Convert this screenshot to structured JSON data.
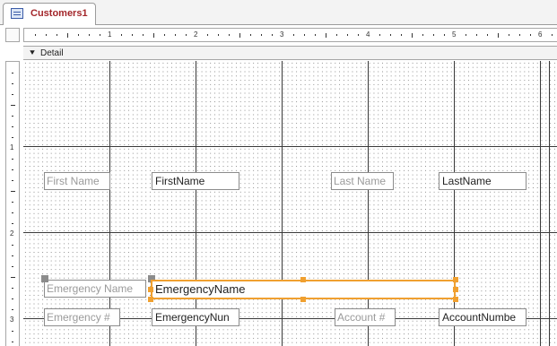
{
  "tab": {
    "title": "Customers1",
    "icon": "form-icon"
  },
  "ruler": {
    "horizontal_marks": [
      "1",
      "2",
      "3",
      "4",
      "5",
      "6"
    ],
    "vertical_marks": [
      "1",
      "2",
      "3"
    ]
  },
  "section": {
    "label": "Detail",
    "icon": "section-arrow-icon"
  },
  "controls": {
    "first_name_label": "First Name",
    "first_name_field": "FirstName",
    "last_name_label": "Last Name",
    "last_name_field": "LastName",
    "emergency_name_label": "Emergency Name",
    "emergency_name_field": "EmergencyName",
    "emergency_num_label": "Emergency #",
    "emergency_num_field": "EmergencyNun",
    "account_label": "Account #",
    "account_field": "AccountNumbe"
  },
  "colors": {
    "tab_title": "#a3262a",
    "selection": "#f0a030",
    "gridline": "#3a3a3a"
  }
}
